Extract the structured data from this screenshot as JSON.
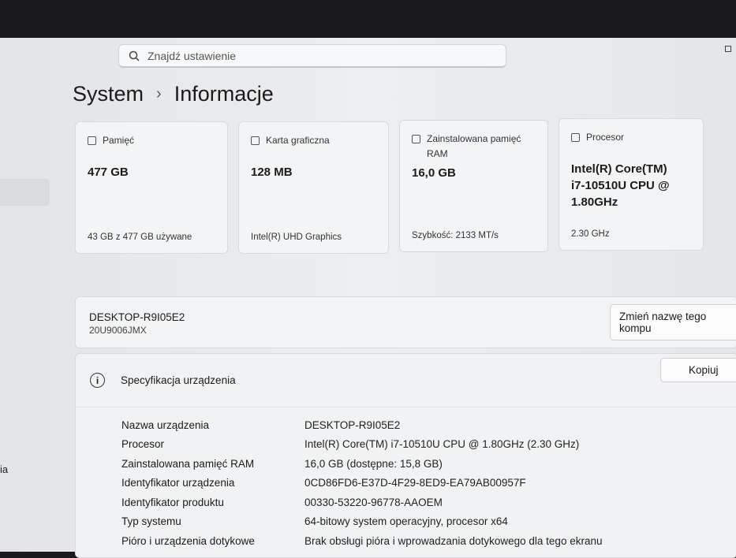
{
  "search": {
    "placeholder": "Znajdź ustawienie"
  },
  "breadcrumb": {
    "parent": "System",
    "separator": "›",
    "current": "Informacje"
  },
  "sidebar": {
    "partial_label": "ia"
  },
  "cards": [
    {
      "title": "Pamięć",
      "value": "477 GB",
      "sub": "43 GB z 477 GB używane",
      "icon": "storage-icon"
    },
    {
      "title": "Karta graficzna",
      "value": "128 MB",
      "sub": "Intel(R) UHD Graphics",
      "icon": "gpu-icon"
    },
    {
      "title": "Zainstalowana pamięć RAM",
      "value": "16,0 GB",
      "sub": "Szybkość: 2133 MT/s",
      "icon": "ram-icon"
    },
    {
      "title": "Procesor",
      "value": "Intel(R) Core(TM) i7-10510U CPU @ 1.80GHz",
      "sub": "2.30 GHz",
      "icon": "cpu-icon"
    }
  ],
  "device": {
    "name": "DESKTOP-R9I05E2",
    "model": "20U9006JMX",
    "rename_label": "Zmień nazwę tego kompu"
  },
  "spec": {
    "title": "Specyfikacja urządzenia",
    "copy_label": "Kopiuj",
    "rows": [
      {
        "k": "Nazwa urządzenia",
        "v": "DESKTOP-R9I05E2"
      },
      {
        "k": "Procesor",
        "v": "Intel(R) Core(TM) i7-10510U CPU @ 1.80GHz (2.30 GHz)"
      },
      {
        "k": "Zainstalowana pamięć RAM",
        "v": "16,0 GB (dostępne: 15,8 GB)"
      },
      {
        "k": "Identyfikator urządzenia",
        "v": "0CD86FD6-E37D-4F29-8ED9-EA79AB00957F"
      },
      {
        "k": "Identyfikator produktu",
        "v": "00330-53220-96778-AAOEM"
      },
      {
        "k": "Typ systemu",
        "v": "64-bitowy system operacyjny, procesor x64"
      },
      {
        "k": "Pióro i urządzenia dotykowe",
        "v": "Brak obsługi pióra i wprowadzania dotykowego dla tego ekranu"
      }
    ]
  }
}
